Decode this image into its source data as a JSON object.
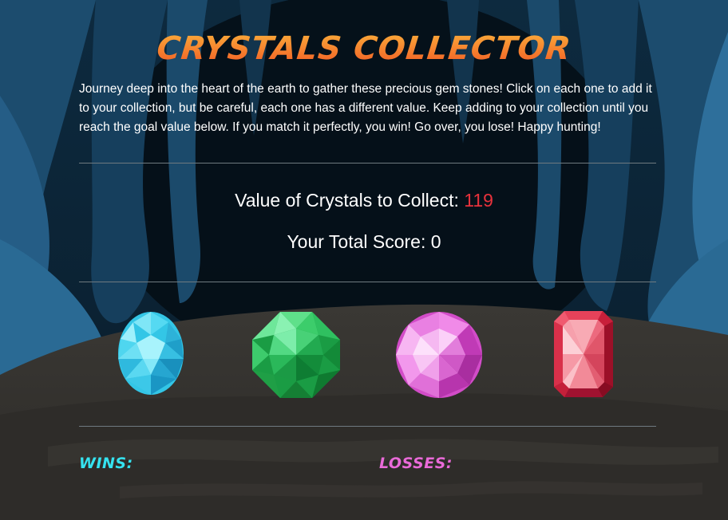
{
  "game": {
    "title": "CRYSTALS COLLECTOR",
    "instructions": "Journey deep into the heart of the earth to gather these precious gem stones! Click on each one to add it to your collection, but be careful, each one has a different value. Keep adding to your collection until you reach the goal value below. If you match it perfectly, you win! Go over, you lose! Happy hunting!",
    "goal_label": "Value of Crystals to Collect: ",
    "goal_value": "119",
    "score_label": "Your Total Score: ",
    "score_value": "0",
    "wins_label": "WINS:",
    "wins_value": "",
    "losses_label": "LOSSES:",
    "losses_value": ""
  },
  "crystals": [
    {
      "name": "blue-oval-crystal",
      "color": "#3fd3ee"
    },
    {
      "name": "green-octagon-crystal",
      "color": "#1fb04a"
    },
    {
      "name": "pink-round-crystal",
      "color": "#e14fd2"
    },
    {
      "name": "red-rectangle-crystal",
      "color": "#d9243e"
    }
  ],
  "colors": {
    "title": "#f26c2a",
    "goal_number": "#e8323c",
    "wins": "#35e3f0",
    "losses": "#e96ad8"
  }
}
